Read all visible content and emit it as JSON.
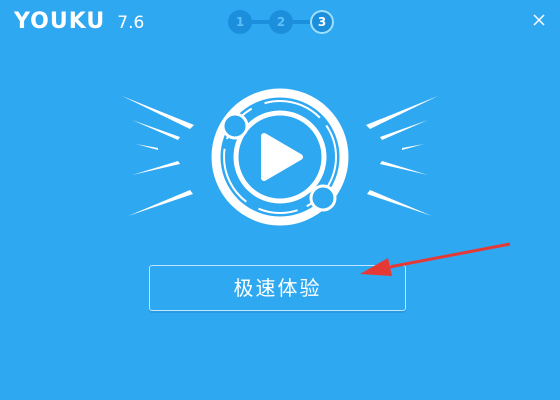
{
  "app": {
    "name": "YOUKU",
    "version": "7.6"
  },
  "steps": [
    {
      "label": "1",
      "active": false
    },
    {
      "label": "2",
      "active": false
    },
    {
      "label": "3",
      "active": true
    }
  ],
  "main": {
    "start_button_label": "极速体验"
  },
  "icons": {
    "close": "close-icon",
    "logo": "youku-play-logo-icon",
    "annotation": "red-arrow-annotation"
  },
  "colors": {
    "background": "#2fa8f2",
    "step_bg": "#1c8fdc",
    "annotation": "#e53935"
  }
}
